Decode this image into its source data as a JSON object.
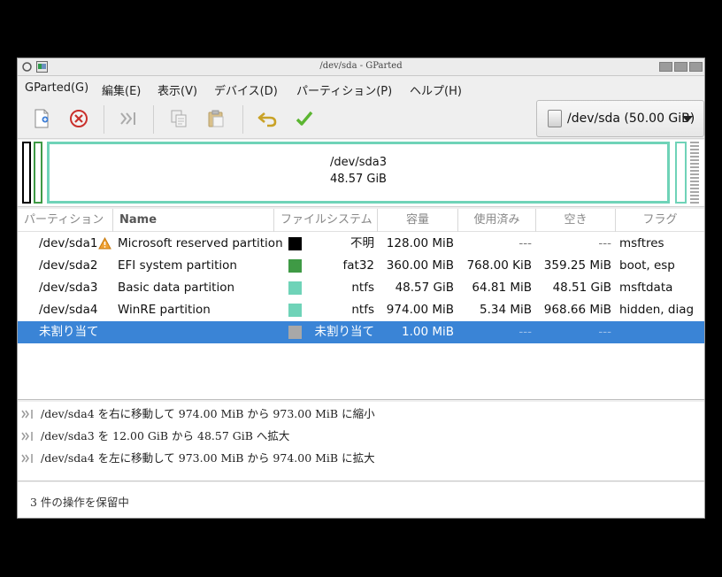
{
  "window": {
    "title": "/dev/sda - GParted"
  },
  "menu": [
    "GParted(G)",
    "編集(E)",
    "表示(V)",
    "デバイス(D)",
    "パーティション(P)",
    "ヘルプ(H)"
  ],
  "toolbar": {
    "new_icon": "new-partition-icon",
    "delete_icon": "delete-icon",
    "resize_icon": "resize-move-icon",
    "copy_icon": "copy-icon",
    "paste_icon": "paste-icon",
    "undo_icon": "undo-icon",
    "apply_icon": "apply-icon"
  },
  "device": {
    "label": "/dev/sda (50.00 GiB)"
  },
  "disk_map": {
    "main_name": "/dev/sda3",
    "main_size": "48.57 GiB"
  },
  "columns": [
    "パーティション",
    "Name",
    "ファイルシステム",
    "容量",
    "使用済み",
    "空き",
    "フラグ"
  ],
  "rows": [
    {
      "partition": "/dev/sda1",
      "name": "Microsoft reserved partition",
      "fs": "不明",
      "fs_color": "#000000",
      "size": "128.00 MiB",
      "used": "---",
      "free": "---",
      "flags": "msftres",
      "warning": true,
      "selected": false
    },
    {
      "partition": "/dev/sda2",
      "name": "EFI system partition",
      "fs": "fat32",
      "fs_color": "#3f9a45",
      "size": "360.00 MiB",
      "used": "768.00 KiB",
      "free": "359.25 MiB",
      "flags": "boot, esp",
      "warning": false,
      "selected": false
    },
    {
      "partition": "/dev/sda3",
      "name": "Basic data partition",
      "fs": "ntfs",
      "fs_color": "#6fd3b8",
      "size": "48.57 GiB",
      "used": "64.81 MiB",
      "free": "48.51 GiB",
      "flags": "msftdata",
      "warning": false,
      "selected": false
    },
    {
      "partition": "/dev/sda4",
      "name": "WinRE partition",
      "fs": "ntfs",
      "fs_color": "#6fd3b8",
      "size": "974.00 MiB",
      "used": "5.34 MiB",
      "free": "968.66 MiB",
      "flags": "hidden, diag",
      "warning": false,
      "selected": false
    },
    {
      "partition": "未割り当て",
      "name": "",
      "fs": "未割り当て",
      "fs_color": "#a8a8a8",
      "size": "1.00 MiB",
      "used": "---",
      "free": "---",
      "flags": "",
      "warning": false,
      "selected": true
    }
  ],
  "operations": [
    "/dev/sda4 を右に移動して 974.00 MiB から 973.00 MiB に縮小",
    "/dev/sda3 を 12.00 GiB から 48.57 GiB へ拡大",
    "/dev/sda4 を左に移動して 973.00 MiB から 974.00 MiB に拡大"
  ],
  "status": "3 件の操作を保留中",
  "colors": {
    "selection": "#3a84d6",
    "ntfs": "#6fd3b8",
    "fat32": "#3f9a45",
    "unknown": "#000000",
    "unallocated": "#a8a8a8"
  }
}
